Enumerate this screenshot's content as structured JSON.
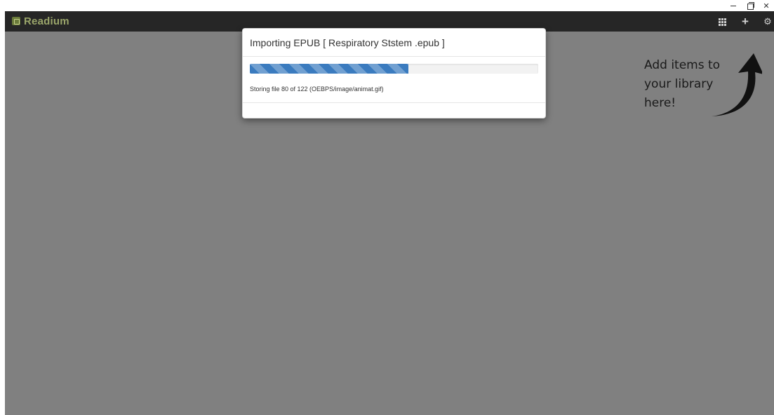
{
  "window_controls": {
    "minimize": "minimize-icon",
    "maximize": "restore-icon",
    "close": "close-icon"
  },
  "app": {
    "name": "Readium",
    "brand_color": "#9aa56a",
    "toolbar_bg": "#262626"
  },
  "toolbar": {
    "icons": [
      "grid-view-icon",
      "add-icon",
      "settings-gear-icon"
    ]
  },
  "backdrop_color": "#808080",
  "hint": {
    "line1": "Add items to",
    "line2": "your library",
    "line3": "here!"
  },
  "dialog": {
    "title": "Importing EPUB [ Respiratory Ststem .epub ]",
    "progress_fraction": 0.55,
    "progress_color": "#3a7bbf",
    "status": "Storing file 80 of 122 (OEBPS/image/animat.gif)"
  }
}
